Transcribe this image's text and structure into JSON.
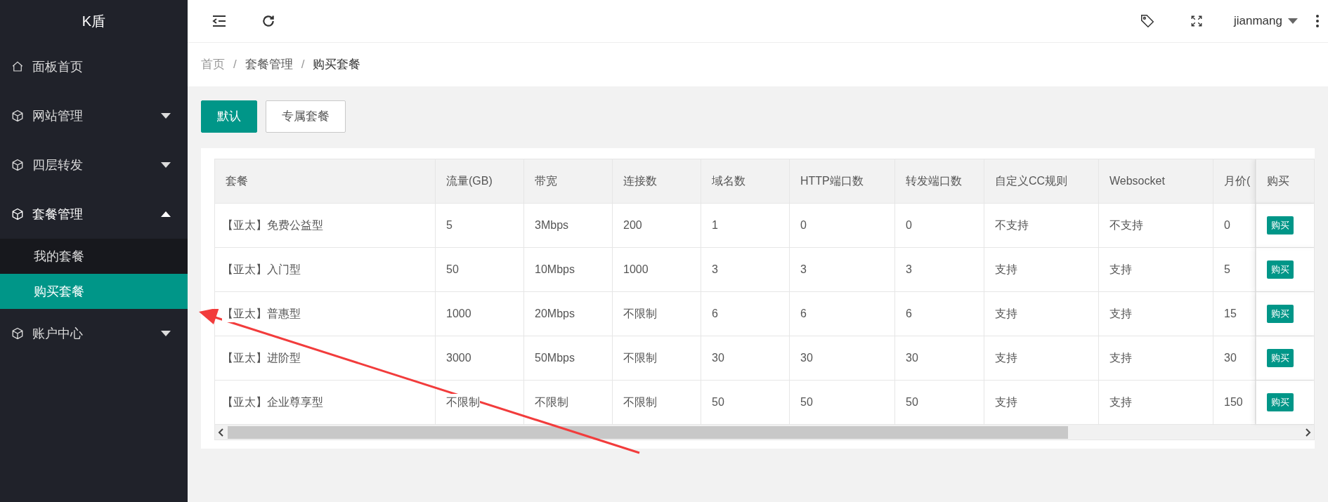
{
  "sidebar": {
    "logo": "K盾",
    "items": [
      {
        "label": "面板首页",
        "kind": "link"
      },
      {
        "label": "网站管理",
        "kind": "group",
        "expanded": false
      },
      {
        "label": "四层转发",
        "kind": "group",
        "expanded": false
      },
      {
        "label": "套餐管理",
        "kind": "group",
        "expanded": true,
        "children": [
          {
            "label": "我的套餐",
            "selected": false
          },
          {
            "label": "购买套餐",
            "selected": true
          }
        ]
      },
      {
        "label": "账户中心",
        "kind": "group",
        "expanded": false
      }
    ]
  },
  "header": {
    "user": "jianmang"
  },
  "breadcrumb": [
    {
      "kind": "link",
      "text": "首页"
    },
    {
      "kind": "separator",
      "text": "/"
    },
    {
      "kind": "link",
      "text": "套餐管理"
    },
    {
      "kind": "separator",
      "text": "/"
    },
    {
      "kind": "current",
      "text": "购买套餐"
    }
  ],
  "tabs": [
    {
      "label": "默认",
      "selected": true
    },
    {
      "label": "专属套餐",
      "selected": false
    }
  ],
  "table": {
    "columns": [
      "套餐",
      "流量(GB)",
      "带宽",
      "连接数",
      "域名数",
      "HTTP端口数",
      "转发端口数",
      "自定义CC规则",
      "Websocket",
      "月价(",
      "购买"
    ],
    "rows": [
      {
        "cells": [
          "【亚太】免费公益型",
          "5",
          "3Mbps",
          "200",
          "1",
          "0",
          "0",
          "不支持",
          "不支持",
          "0"
        ],
        "action": "购买"
      },
      {
        "cells": [
          "【亚太】入门型",
          "50",
          "10Mbps",
          "1000",
          "3",
          "3",
          "3",
          "支持",
          "支持",
          "5"
        ],
        "action": "购买"
      },
      {
        "cells": [
          "【亚太】普惠型",
          "1000",
          "20Mbps",
          "不限制",
          "6",
          "6",
          "6",
          "支持",
          "支持",
          "15"
        ],
        "action": "购买"
      },
      {
        "cells": [
          "【亚太】进阶型",
          "3000",
          "50Mbps",
          "不限制",
          "30",
          "30",
          "30",
          "支持",
          "支持",
          "30"
        ],
        "action": "购买"
      },
      {
        "cells": [
          "【亚太】企业尊享型",
          "不限制",
          "不限制",
          "不限制",
          "50",
          "50",
          "50",
          "支持",
          "支持",
          "150"
        ],
        "action": "购买"
      }
    ]
  }
}
